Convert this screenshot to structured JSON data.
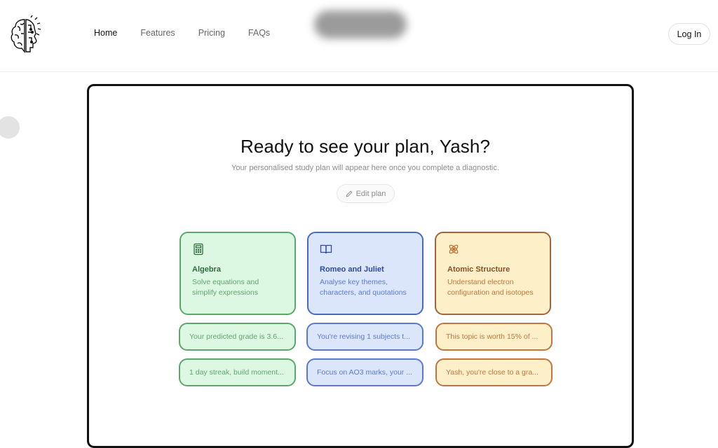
{
  "nav": {
    "items": [
      {
        "label": "Home",
        "active": true
      },
      {
        "label": "Features",
        "active": false
      },
      {
        "label": "Pricing",
        "active": false
      },
      {
        "label": "FAQs",
        "active": false
      }
    ],
    "login_label": "Log In"
  },
  "hero": {
    "title": "Ready to see your plan, Yash?",
    "subtitle": "Your personalised study plan will appear here once you complete a diagnostic.",
    "edit_label": "Edit plan"
  },
  "cards": [
    {
      "icon": "calculator-icon",
      "title": "Algebra",
      "desc_line1": "Solve equations and",
      "desc_line2": "simplify expressions",
      "color": "#5aa86a"
    },
    {
      "icon": "book-open-icon",
      "title": "Romeo and Juliet",
      "desc_line1": "Analyse key themes,",
      "desc_line2": "characters, and quotations",
      "color": "#4a69c6"
    },
    {
      "icon": "atom-icon",
      "title": "Atomic Structure",
      "desc_line1": "Understand electron",
      "desc_line2": "configuration and isotopes",
      "color": "#a2643a"
    }
  ],
  "pills_row1": [
    "Your predicted grade is 3.6...",
    "You're revising 1 subjects t...",
    "This topic is worth 15% of ..."
  ],
  "pills_row2": [
    "1 day streak, build moment...",
    "Focus on AO3 marks, your ...",
    "Yash, you're close to a gra..."
  ]
}
